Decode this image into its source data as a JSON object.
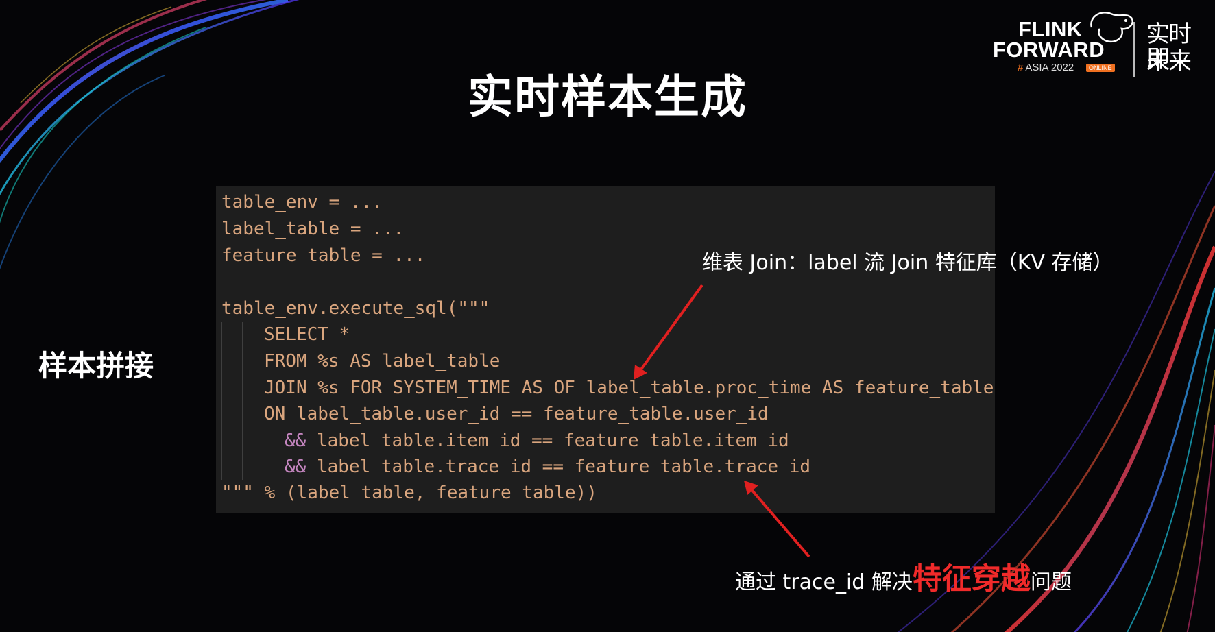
{
  "slide": {
    "title": "实时样本生成",
    "side_label": "样本拼接"
  },
  "logo": {
    "line1": "FLINK",
    "line2": "FORWARD",
    "hash": "#",
    "event": "ASIA 2022",
    "badge": "ONLINE",
    "cn_line1": "实时即",
    "cn_line2": "未来"
  },
  "code": {
    "lines": [
      "table_env = ...",
      "label_table = ...",
      "feature_table = ...",
      "table_env.execute_sql(\"\"\"",
      "SELECT *",
      "FROM %s AS label_table",
      "JOIN %s FOR SYSTEM_TIME AS OF label_table.proc_time AS feature_table",
      "ON label_table.user_id == feature_table.user_id",
      "&&",
      " label_table.item_id == feature_table.item_id",
      "&&",
      " label_table.trace_id == feature_table.trace_id",
      "\"\"\" % (label_table, feature_table))"
    ]
  },
  "annotations": {
    "top": "维表 Join：label 流 Join 特征库（KV 存储）",
    "bottom_prefix": "通过 trace_id 解决",
    "bottom_highlight": "特征穿越",
    "bottom_suffix": "问题"
  },
  "colors": {
    "background": "#050507",
    "code_bg": "#1e1e1e",
    "code_text": "#d9a57e",
    "code_operator": "#c586c0",
    "arrow": "#e02020",
    "highlight": "#f02a2a",
    "brand_orange": "#f07020"
  }
}
